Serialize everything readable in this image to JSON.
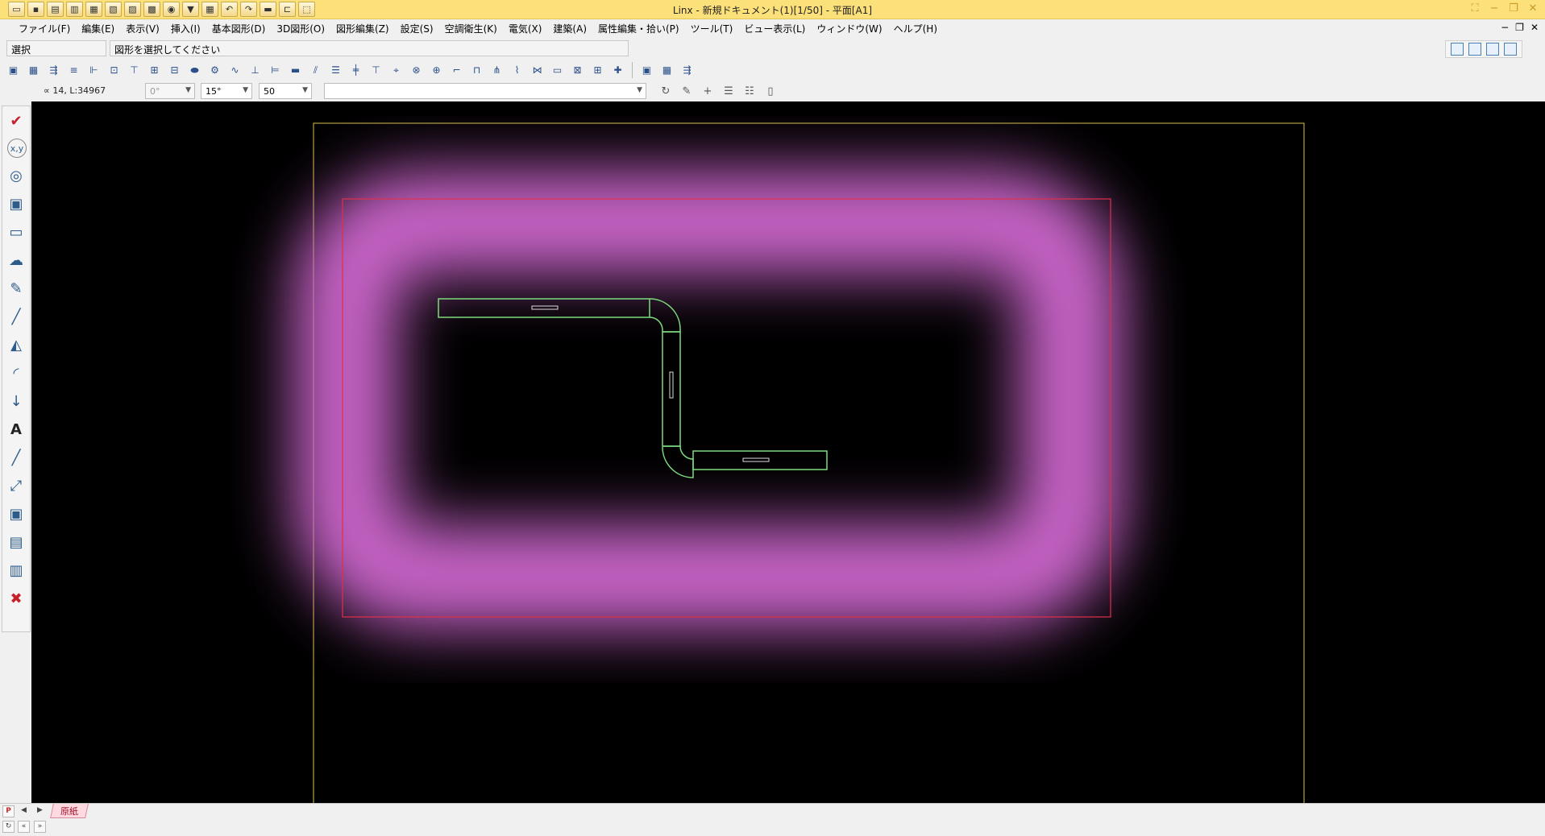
{
  "window": {
    "title": "Linx - 新規ドキュメント(1)[1/50] - 平面[A1]",
    "qat_icons": [
      "folder-open-icon",
      "save-icon",
      "print-icon",
      "cut-icon",
      "copy-icon",
      "paste-icon",
      "grid-icon",
      "page-icon",
      "target-icon",
      "filter-icon",
      "table-icon",
      "undo-icon",
      "redo-icon",
      "measure-icon",
      "select-icon",
      "frame-icon"
    ],
    "controls": [
      "fullscreen-icon",
      "minimize-icon",
      "restore-icon",
      "close-icon"
    ]
  },
  "menu": {
    "items": [
      "ファイル(F)",
      "編集(E)",
      "表示(V)",
      "挿入(I)",
      "基本図形(D)",
      "3D図形(O)",
      "図形編集(Z)",
      "設定(S)",
      "空調衛生(K)",
      "電気(X)",
      "建築(A)",
      "属性編集・拾い(P)",
      "ツール(T)",
      "ビュー表示(L)",
      "ウィンドウ(W)",
      "ヘルプ(H)"
    ],
    "mdi_controls": [
      "−",
      "❐",
      "✕"
    ]
  },
  "status": {
    "mode": "選択",
    "prompt": "図形を選択してください"
  },
  "properties": {
    "coordinate": "∝ 14, L:34967",
    "angle": "0°",
    "snap_angle": "15°",
    "scale": "50",
    "layer": ""
  },
  "toolbar": {
    "icons": [
      "duct-icon",
      "calc-icon",
      "riser-icon",
      "flange-icon",
      "valve-icon",
      "tee-icon",
      "branch-icon",
      "hanger-icon",
      "reducer-icon",
      "elbow-icon",
      "connect-icon",
      "insulation-icon",
      "support-icon",
      "pipe-icon",
      "slope-icon",
      "stack-icon",
      "cross-icon",
      "fitting-icon",
      "port-icon",
      "link-icon",
      "globe-icon",
      "joint-icon",
      "bend-icon",
      "tree-icon",
      "grade-icon",
      "curve-icon",
      "offset-icon",
      "rack-icon",
      "label-icon",
      "sleeve-icon",
      "bundle-icon",
      "layout-icon",
      "view-icon",
      "schedule-icon"
    ]
  },
  "palette": {
    "tools": [
      {
        "name": "check-icon",
        "glyph": "✔"
      },
      {
        "name": "coordinate-icon",
        "glyph": "x,y"
      },
      {
        "name": "shape-icon",
        "glyph": "◎"
      },
      {
        "name": "create-icon",
        "glyph": "▣"
      },
      {
        "name": "scale-icon",
        "glyph": "▭"
      },
      {
        "name": "cloud-icon",
        "glyph": "☁"
      },
      {
        "name": "pen-icon",
        "glyph": "✎"
      },
      {
        "name": "line-icon",
        "glyph": "╱"
      },
      {
        "name": "mirror-icon",
        "glyph": "◭"
      },
      {
        "name": "arc-icon",
        "glyph": "◜"
      },
      {
        "name": "dimension-icon",
        "glyph": "↓"
      },
      {
        "name": "text-icon",
        "glyph": "A"
      },
      {
        "name": "draw-line-icon",
        "glyph": "╱"
      },
      {
        "name": "resize-icon",
        "glyph": "⤢"
      },
      {
        "name": "new-shape-icon",
        "glyph": "▣"
      },
      {
        "name": "window-icon",
        "glyph": "▤"
      },
      {
        "name": "copy-shape-icon",
        "glyph": "▥"
      },
      {
        "name": "delete-select-icon",
        "glyph": "✖"
      }
    ]
  },
  "sheet": {
    "tab_label": "原紙"
  },
  "colors": {
    "title_bar": "#fce07a",
    "canvas": "#000000",
    "paper_border": "#d8c34a",
    "highlight": "#c864c8",
    "highlight_border": "#e0304a",
    "duct": "#7ddc7d"
  }
}
